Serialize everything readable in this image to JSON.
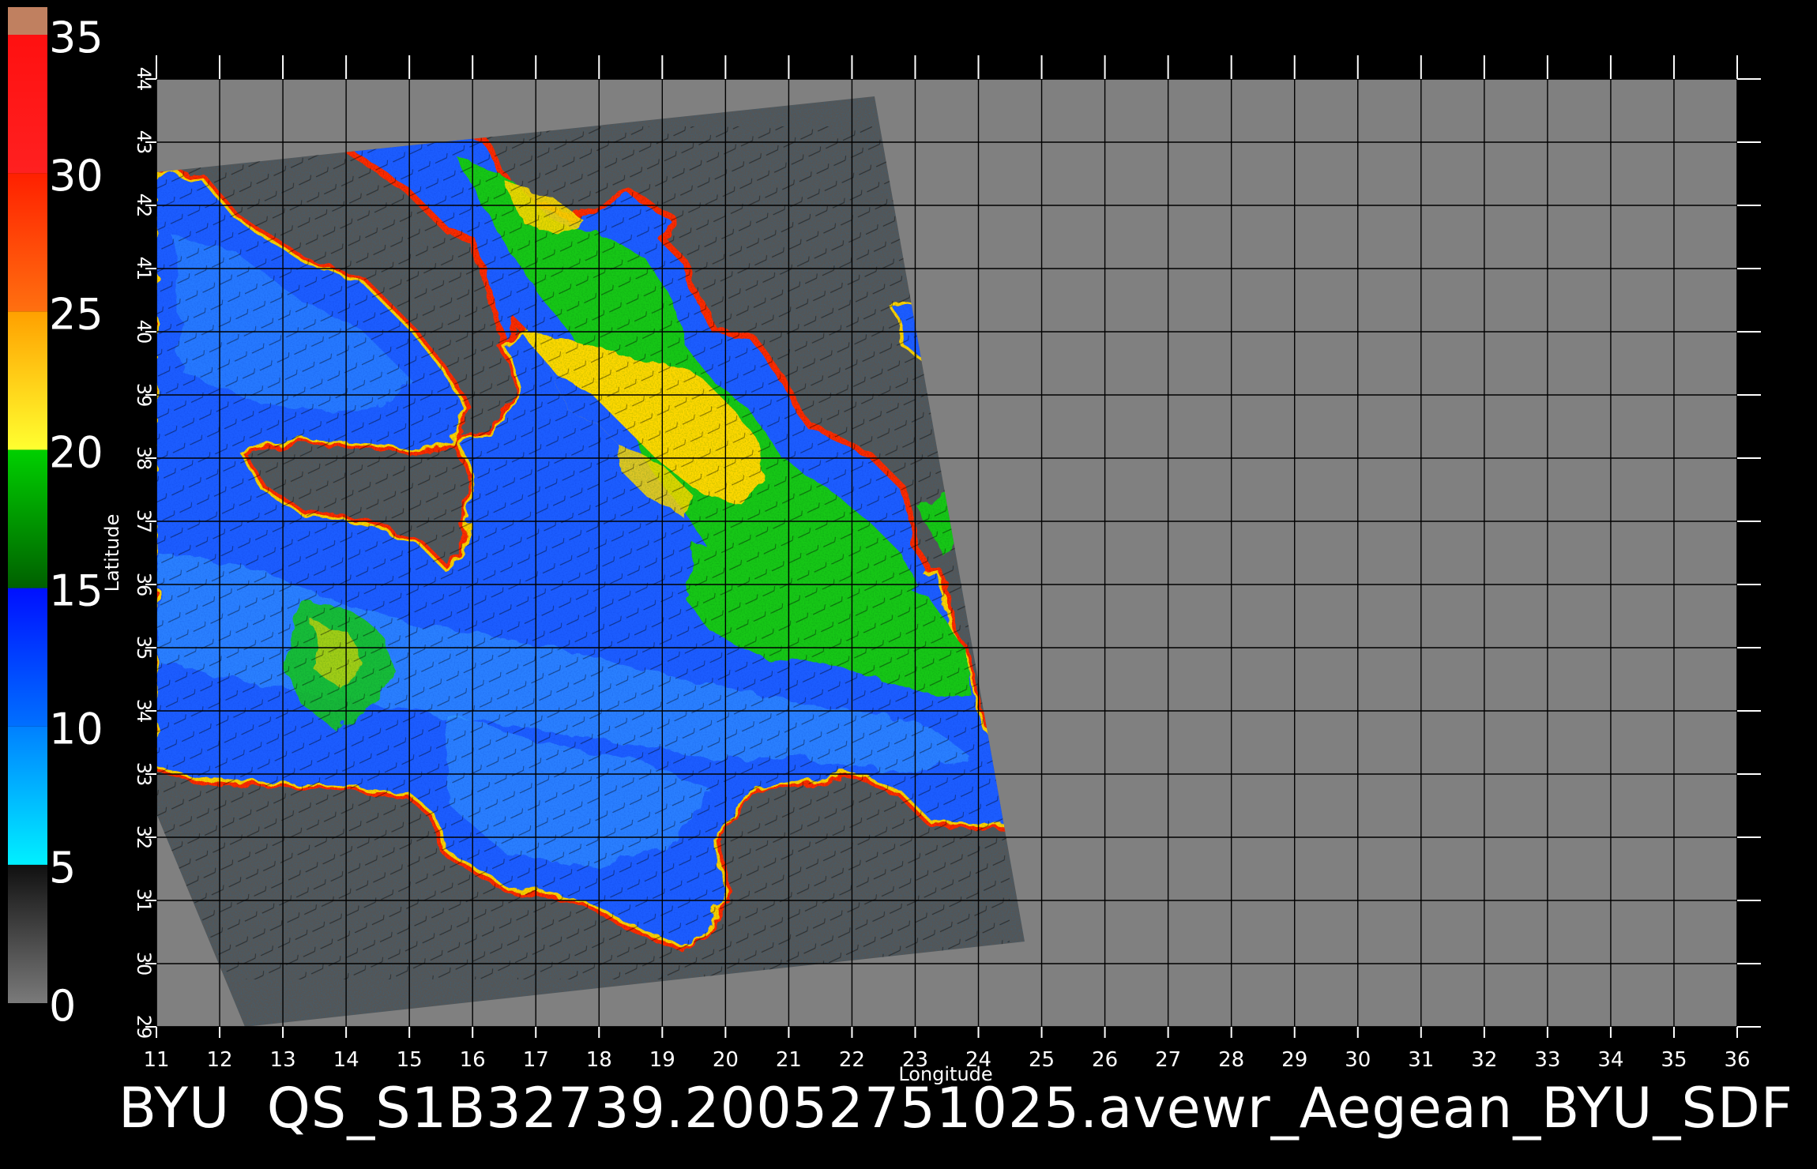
{
  "colorbar": {
    "ticks": [
      "0",
      "5",
      "10",
      "15",
      "20",
      "25",
      "30",
      "35"
    ],
    "bands": [
      {
        "from": 0,
        "to": 5,
        "top": "#101010",
        "bottom": "#7a7a7a"
      },
      {
        "from": 5,
        "to": 10,
        "top": "#0080ff",
        "bottom": "#00f0ff"
      },
      {
        "from": 10,
        "to": 15,
        "top": "#0010ff",
        "bottom": "#0070ff"
      },
      {
        "from": 15,
        "to": 20,
        "top": "#00d000",
        "bottom": "#006000"
      },
      {
        "from": 20,
        "to": 25,
        "top": "#ffa000",
        "bottom": "#ffff30"
      },
      {
        "from": 25,
        "to": 30,
        "top": "#ff2000",
        "bottom": "#ff7010"
      },
      {
        "from": 30,
        "to": 35,
        "top": "#ff1010",
        "bottom": "#ff2020"
      },
      {
        "from": 35,
        "to": 36,
        "top": "#c08060",
        "bottom": "#c08060"
      }
    ]
  },
  "map": {
    "lon_range": [
      11,
      36
    ],
    "lat_range": [
      29,
      44
    ],
    "lon_ticks": [
      "11",
      "12",
      "13",
      "14",
      "15",
      "16",
      "17",
      "18",
      "19",
      "20",
      "21",
      "22",
      "23",
      "24",
      "25",
      "26",
      "27",
      "28",
      "29",
      "30",
      "31",
      "32",
      "33",
      "34",
      "35",
      "36"
    ],
    "lat_ticks": [
      "29",
      "30",
      "31",
      "32",
      "33",
      "34",
      "35",
      "36",
      "37",
      "38",
      "39",
      "40",
      "41",
      "42",
      "43",
      "44"
    ],
    "xlabel": "Longitude",
    "ylabel": "Latitude",
    "colors": {
      "background": "#000000",
      "frame": "#808080",
      "swath": "#555555",
      "grid": "#000000",
      "text": "#ffffff"
    }
  },
  "caption": "BYU  QS_S1B32739.20052751025.avewr_Aegean_BYU_SDF"
}
